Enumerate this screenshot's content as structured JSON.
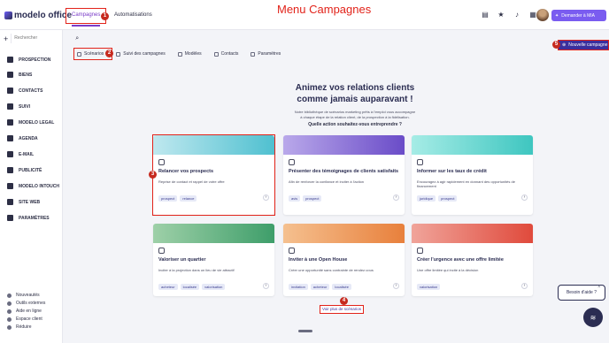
{
  "app": {
    "logo_text": "modelo office"
  },
  "header": {
    "annotation_title": "Menu Campagnes",
    "nav": [
      {
        "label": "Campagnes"
      },
      {
        "label": "Automatisations"
      }
    ],
    "icons": [
      "stack-icon",
      "star-icon",
      "bell-icon",
      "grid-icon"
    ],
    "ask_button": "Demander à MIA",
    "colors": {
      "accent": "#7a3cc8",
      "annotation_red": "#e2231a",
      "navy": "#2b2d52"
    }
  },
  "sidebar": {
    "search_placeholder": "Rechercher",
    "items": [
      {
        "label": "PROSPECTION",
        "icon": "target-icon"
      },
      {
        "label": "BIENS",
        "icon": "home-icon"
      },
      {
        "label": "CONTACTS",
        "icon": "contacts-icon"
      },
      {
        "label": "SUIVI",
        "icon": "folder-icon"
      },
      {
        "label": "MODELO LEGAL",
        "icon": "legal-icon"
      },
      {
        "label": "AGENDA",
        "icon": "calendar-icon"
      },
      {
        "label": "E-MAIL",
        "icon": "mail-icon"
      },
      {
        "label": "PUBLICITÉ",
        "icon": "megaphone-icon"
      },
      {
        "label": "MODELO INTOUCH",
        "icon": "intouch-icon"
      },
      {
        "label": "SITE WEB",
        "icon": "globe-icon"
      },
      {
        "label": "PARAMÈTRES",
        "icon": "gear-icon"
      }
    ],
    "footer": [
      {
        "label": "Nouveautés"
      },
      {
        "label": "Outils externes"
      },
      {
        "label": "Aide en ligne"
      },
      {
        "label": "Espace client"
      },
      {
        "label": "Réduire"
      }
    ]
  },
  "subtabs": [
    {
      "label": "Scénarios"
    },
    {
      "label": "Suivi des campagnes"
    },
    {
      "label": "Modèles"
    },
    {
      "label": "Contacts"
    },
    {
      "label": "Paramètres"
    }
  ],
  "new_campaign_button": "Nouvelle campagne",
  "hero": {
    "title_line1": "Animez vos relations clients",
    "title_line2": "comme jamais auparavant !",
    "text_line1": "Notre bibliothèque de scénarios marketing prêts à l'emploi vous accompagne",
    "text_line2": "à chaque étape de la relation client, de la prospection à la fidélisation.",
    "question": "Quelle action souhaitez-vous entreprendre ?"
  },
  "cards": [
    {
      "title": "Relancer vos prospects",
      "desc": "Reprise de contact et rappel de votre offre",
      "tags": [
        "prospect",
        "relance"
      ],
      "color": "#4fc0d0"
    },
    {
      "title": "Présenter des témoignages de clients satisfaits",
      "desc": "Afin de renforcer la confiance et inciter à l'action",
      "tags": [
        "avis",
        "prospect"
      ],
      "color": "#6a4cc8"
    },
    {
      "title": "Informer sur les taux de crédit",
      "desc": "Encouragez à agir rapidement en donnant des opportunités de financement",
      "tags": [
        "juridique",
        "prospect"
      ],
      "color": "#3ec6c0"
    },
    {
      "title": "Valoriser un quartier",
      "desc": "Inciter à la projection dans un lieu de vie attractif",
      "tags": [
        "acheteur",
        "localisée",
        "valorisation"
      ],
      "color": "#3e9e6a"
    },
    {
      "title": "Inviter à une Open House",
      "desc": "Créer une opportunité sans contrainte de rendez-vous",
      "tags": [
        "invitation",
        "acheteur",
        "localisée"
      ],
      "color": "#e8803c"
    },
    {
      "title": "Créer l'urgence avec une offre limitée",
      "desc": "Une offre limitée qui incite à la décision",
      "tags": [
        "valorisation"
      ],
      "color": "#e04a3c"
    }
  ],
  "more_button": "Voir plus de scénarios",
  "markers": [
    "1",
    "2",
    "3",
    "4",
    "5"
  ],
  "help": {
    "bubble": "Besoin d'aide ?"
  }
}
